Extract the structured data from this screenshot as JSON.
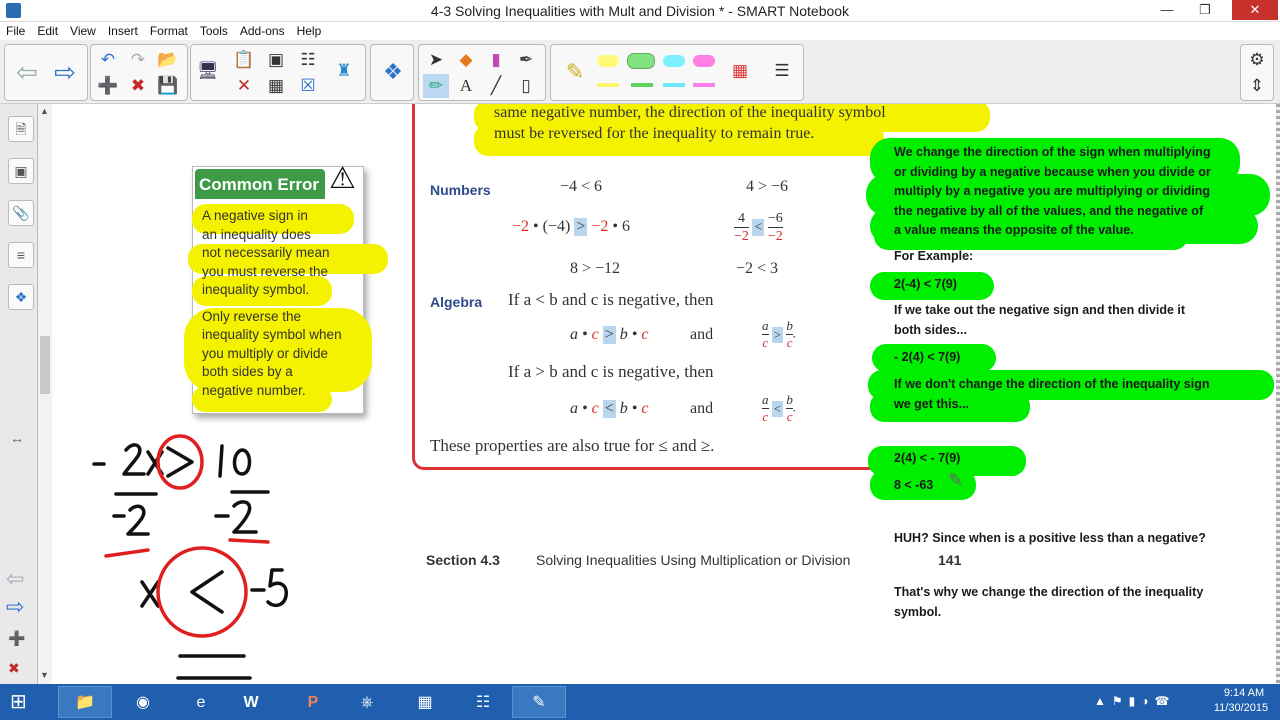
{
  "window": {
    "title": "4-3 Solving Inequalities with Mult and Division * - SMART Notebook",
    "minimize": "—",
    "restore": "❐",
    "close": "✕"
  },
  "menu": [
    "File",
    "Edit",
    "View",
    "Insert",
    "Format",
    "Tools",
    "Add-ons",
    "Help"
  ],
  "toolbar": {
    "icons": [
      "back-icon",
      "forward-icon",
      "undo-icon",
      "redo-icon",
      "open-icon",
      "add-page-icon",
      "delete-page-icon",
      "save-icon",
      "screen-shade-icon",
      "paste-icon",
      "delete-icon",
      "table-icon",
      "clear-page-icon",
      "screen-capture-icon",
      "fill-icon",
      "addon-icon",
      "select-icon",
      "shapes-icon",
      "eraser-tool-icon",
      "magic-pen-icon",
      "pens-icon",
      "text-icon",
      "line-icon",
      "eraser-icon",
      "highlighter-icon",
      "color-palette-icon",
      "properties-icon",
      "settings-icon",
      "move-toolbar-icon"
    ]
  },
  "book": {
    "top_rule_1": "same negative number, the direction of the inequality symbol",
    "top_rule_2": "must be reversed for the inequality to remain true.",
    "numbers_label": "Numbers",
    "algebra_label": "Algebra",
    "n1a": "−4 < 6",
    "n1b": "4 > −6",
    "n3a": "8 > −12",
    "n3b": "−2 < 3",
    "alg1": "If a < b and c is negative, then",
    "alg2": "If a > b and c is negative, then",
    "and": "and",
    "closing": "These properties are also true for ≤ and ≥.",
    "footer_section": "Section 4.3",
    "footer_title": "Solving Inequalities Using Multiplication or Division",
    "footer_page": "141"
  },
  "common_error": {
    "header": "Common Error",
    "p1_lines": [
      "A negative sign in",
      "an inequality does",
      "not necessarily mean",
      "you must reverse the",
      "inequality symbol."
    ],
    "p2_lines": [
      "Only reverse the",
      "inequality symbol when",
      "you multiply or divide",
      "both sides by a",
      "negative number."
    ]
  },
  "notes": {
    "explain_lines": [
      "We change the direction of the sign when multiplying",
      "or dividing by a negative because when you divide or",
      "multiply by a negative you are multiplying or dividing",
      "the negative by all of the values, and the negative of",
      "a value means the opposite of the value."
    ],
    "for_example": "For Example:",
    "ex1": "2(-4) < 7(9)",
    "take_out_lines": [
      "If we take out the negative sign and then divide it",
      "both sides..."
    ],
    "ex2": "- 2(4) < 7(9)",
    "dont_change_lines": [
      "If we don't change the direction of the inequality sign",
      "we get this..."
    ],
    "ex3": "2(4) < - 7(9)",
    "ex4": "8 < -63",
    "huh": "HUH? Since when is a positive less than a negative?",
    "thats_why_lines": [
      "That's why we change the direction of the inequality",
      "symbol."
    ]
  },
  "tray": {
    "time": "9:14 AM",
    "date": "11/30/2015"
  },
  "colors": {
    "highlight_yellow": "#f5f200",
    "highlight_green": "#00ee00",
    "ink_red": "#e02020",
    "taskbar": "#1f5fae"
  }
}
